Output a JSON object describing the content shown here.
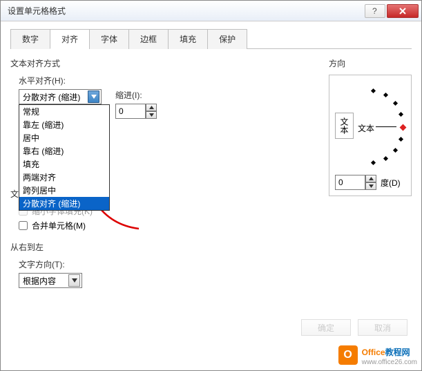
{
  "window": {
    "title": "设置单元格格式"
  },
  "tabs": [
    "数字",
    "对齐",
    "字体",
    "边框",
    "填充",
    "保护"
  ],
  "active_tab": 1,
  "text_alignment": {
    "section": "文本对齐方式",
    "h_label": "水平对齐(H):",
    "h_value": "分散对齐 (缩进)",
    "h_options": [
      "常规",
      "靠左 (缩进)",
      "居中",
      "靠右 (缩进)",
      "填充",
      "两端对齐",
      "跨列居中",
      "分散对齐 (缩进)"
    ],
    "indent_label": "缩进(I):",
    "indent_value": "0"
  },
  "text_control": {
    "section": "文",
    "shrink": "缩小字体填充(K)",
    "merge": "合并单元格(M)"
  },
  "rtl": {
    "section": "从右到左",
    "dir_label": "文字方向(T):",
    "dir_value": "根据内容"
  },
  "orientation": {
    "section": "方向",
    "vert_text": "文本",
    "h_text": "文本",
    "deg_value": "0",
    "deg_label": "度(D)"
  },
  "buttons": {
    "ok": "确定",
    "cancel": "取消"
  },
  "watermark": {
    "brand_a": "Office",
    "brand_b": "教程网",
    "url": "www.office26.com"
  }
}
